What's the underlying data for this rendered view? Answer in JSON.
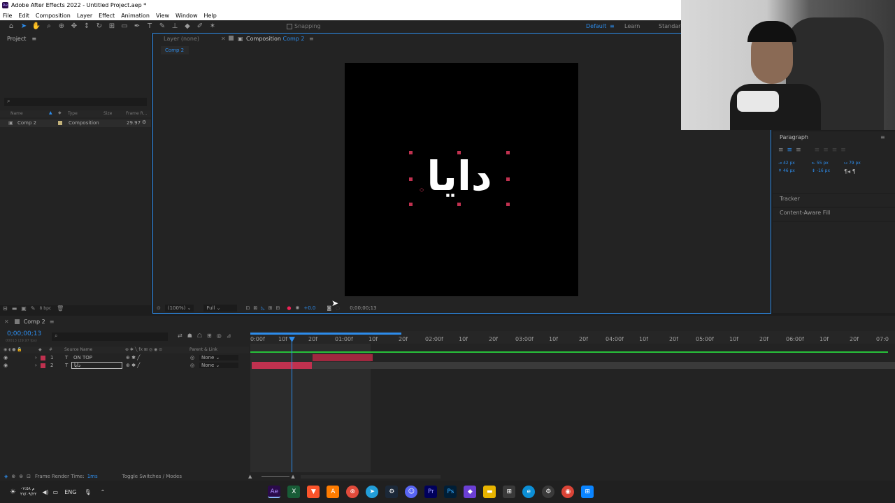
{
  "window": {
    "title": "Adobe After Effects 2022 - Untitled Project.aep *"
  },
  "menu": [
    "File",
    "Edit",
    "Composition",
    "Layer",
    "Effect",
    "Animation",
    "View",
    "Window",
    "Help"
  ],
  "toolbar": {
    "snapping": "Snapping"
  },
  "workspaces": {
    "default": "Default",
    "learn": "Learn",
    "standard": "Standard"
  },
  "project": {
    "title": "Project",
    "columns": [
      "Name",
      "Type",
      "Size",
      "Frame R..."
    ],
    "items": [
      {
        "name": "Comp 2",
        "type": "Composition",
        "frame_rate": "29.97"
      }
    ],
    "bpc": "8 bpc"
  },
  "viewer": {
    "layer_tab": "Layer (none)",
    "comp_tab_prefix": "Composition",
    "comp_tab_name": "Comp 2",
    "breadcrumb": "Comp 2",
    "text": "دايا",
    "zoom": "(100%)",
    "resolution": "Full",
    "exposure": "+0.0",
    "timecode": "0;00;00;13"
  },
  "right": {
    "paragraph": "Paragraph",
    "tracker": "Tracker",
    "caf": "Content-Aware Fill",
    "fields": [
      "42 px",
      "55 px",
      "79 px",
      "46 px",
      "-16 px"
    ]
  },
  "timeline": {
    "tab": "Comp 2",
    "timecode": "0;00;00;13",
    "fps_info": "00013 (29.97 fps)",
    "headers": {
      "source": "Source Name",
      "parent": "Parent & Link"
    },
    "layers": [
      {
        "num": "1",
        "name": "ON TOP",
        "parent": "None"
      },
      {
        "num": "2",
        "name": "دايا",
        "parent": "None"
      }
    ],
    "ruler": [
      "0:00f",
      "10f",
      "20f",
      "01:00f",
      "10f",
      "20f",
      "02:00f",
      "10f",
      "20f",
      "03:00f",
      "10f",
      "20f",
      "04:00f",
      "10f",
      "20f",
      "05:00f",
      "10f",
      "20f",
      "06:00f",
      "10f",
      "20f",
      "07:0"
    ]
  },
  "status": {
    "render": "Frame Render Time:",
    "render_val": "1ms",
    "toggle": "Toggle Switches / Modes"
  },
  "taskbar": {
    "lang": "ENG",
    "clock_time": "۰۷:۵۸ م",
    "clock_date": "۲۷/۰۹/۲۲"
  },
  "colors": {
    "accent": "#2d8ceb",
    "layer_red": "#c0314f",
    "green": "#27c13a"
  }
}
